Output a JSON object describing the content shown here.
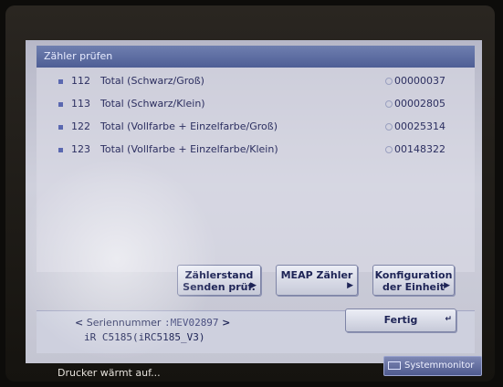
{
  "window": {
    "title": "Zähler prüfen"
  },
  "counters": [
    {
      "number": "112",
      "label": "Total (Schwarz/Groß)",
      "value": "00000037"
    },
    {
      "number": "113",
      "label": "Total (Schwarz/Klein)",
      "value": "00002805"
    },
    {
      "number": "122",
      "label": "Total (Vollfarbe + Einzelfarbe/Groß)",
      "value": "00025314"
    },
    {
      "number": "123",
      "label": "Total (Vollfarbe + Einzelfarbe/Klein)",
      "value": "00148322"
    }
  ],
  "buttons": {
    "send_counter": {
      "line1": "Zählerstand",
      "line2": "Senden prüf."
    },
    "meap_counter": {
      "line1": "MEAP Zähler"
    },
    "unit_config": {
      "line1": "Konfiguration",
      "line2": "der Einheit"
    },
    "done": "Fertig"
  },
  "device": {
    "serial_label": "Seriennummer",
    "serial_value": ":MEV02897",
    "model": "iR C5185(iRC5185_V3)"
  },
  "status": {
    "message": "Drucker wärmt auf...",
    "system_monitor": "Systemmonitor"
  },
  "colors": {
    "title_bar": "#5a6aa0",
    "screen_bg": "#c4c5d2",
    "text": "#2c2f60"
  }
}
